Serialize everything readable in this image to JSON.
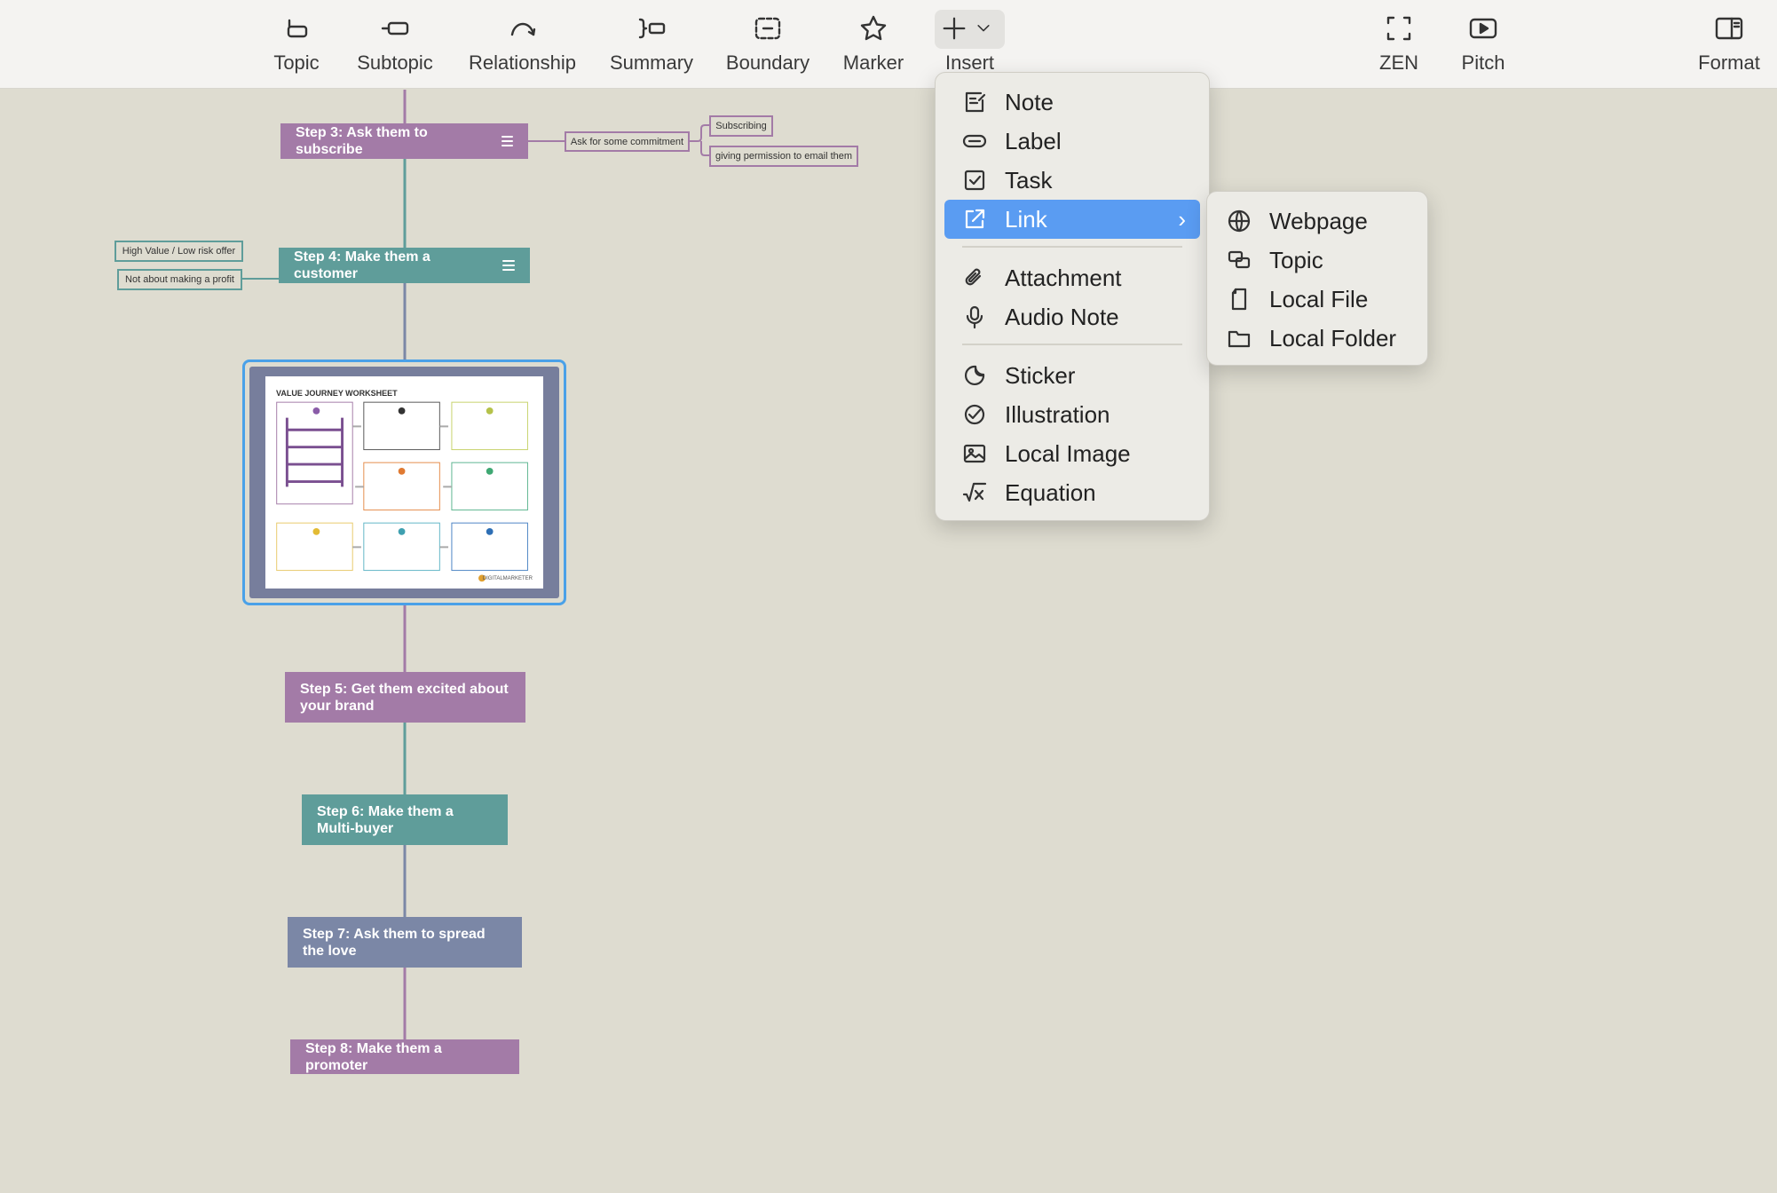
{
  "toolbar": {
    "items": [
      {
        "label": "Topic",
        "icon": "topic-icon"
      },
      {
        "label": "Subtopic",
        "icon": "subtopic-icon"
      },
      {
        "label": "Relationship",
        "icon": "relationship-icon"
      },
      {
        "label": "Summary",
        "icon": "summary-icon"
      },
      {
        "label": "Boundary",
        "icon": "boundary-icon"
      },
      {
        "label": "Marker",
        "icon": "star-icon"
      },
      {
        "label": "Insert",
        "icon": "plus-icon"
      },
      {
        "label": "ZEN",
        "icon": "zen-icon"
      },
      {
        "label": "Pitch",
        "icon": "play-icon"
      },
      {
        "label": "Format",
        "icon": "sidebar-icon"
      }
    ]
  },
  "mindmap": {
    "topics": [
      {
        "text": "Step 3: Ask them to subscribe",
        "color": "#a37ba7",
        "has_note": true
      },
      {
        "text": "Step 4: Make them a customer",
        "color": "#5f9d9a",
        "has_note": true
      },
      {
        "text": "Step 5: Get them excited about your brand",
        "color": "#a37ba7",
        "has_note": false
      },
      {
        "text": "Step 6: Make them a Multi-buyer",
        "color": "#5f9d9a",
        "has_note": false
      },
      {
        "text": "Step 7: Ask them to spread the love",
        "color": "#7b87a6",
        "has_note": false
      },
      {
        "text": "Step 8: Make them a promoter",
        "color": "#a37ba7",
        "has_note": false
      }
    ],
    "subtopics": {
      "ask_commitment": "Ask for some commitment",
      "subscribing": "Subscribing",
      "giving_permission": "giving permission to email them",
      "high_value": "High Value / Low risk offer",
      "not_profit": "Not about making a profit"
    },
    "image_topic": {
      "title": "VALUE JOURNEY WORKSHEET",
      "logo_text": "DIGITALMARKETER"
    }
  },
  "insert_menu": {
    "items": [
      {
        "label": "Note",
        "icon": "note-icon"
      },
      {
        "label": "Label",
        "icon": "label-icon"
      },
      {
        "label": "Task",
        "icon": "checkbox-icon"
      },
      {
        "label": "Link",
        "icon": "link-icon",
        "has_submenu": true,
        "highlighted": true
      },
      {
        "label": "Attachment",
        "icon": "paperclip-icon"
      },
      {
        "label": "Audio Note",
        "icon": "microphone-icon"
      },
      {
        "label": "Sticker",
        "icon": "sticker-icon"
      },
      {
        "label": "Illustration",
        "icon": "illustration-icon"
      },
      {
        "label": "Local Image",
        "icon": "image-icon"
      },
      {
        "label": "Equation",
        "icon": "equation-icon"
      }
    ]
  },
  "link_submenu": {
    "items": [
      {
        "label": "Webpage",
        "icon": "globe-icon"
      },
      {
        "label": "Topic",
        "icon": "topic-link-icon"
      },
      {
        "label": "Local File",
        "icon": "file-icon"
      },
      {
        "label": "Local Folder",
        "icon": "folder-icon"
      }
    ]
  },
  "colors": {
    "canvas_bg": "#dedcd0",
    "purple": "#a37ba7",
    "teal": "#5f9d9a",
    "slate": "#7b87a6",
    "selection": "#4aa1e8",
    "menu_highlight": "#5a9cf2"
  }
}
